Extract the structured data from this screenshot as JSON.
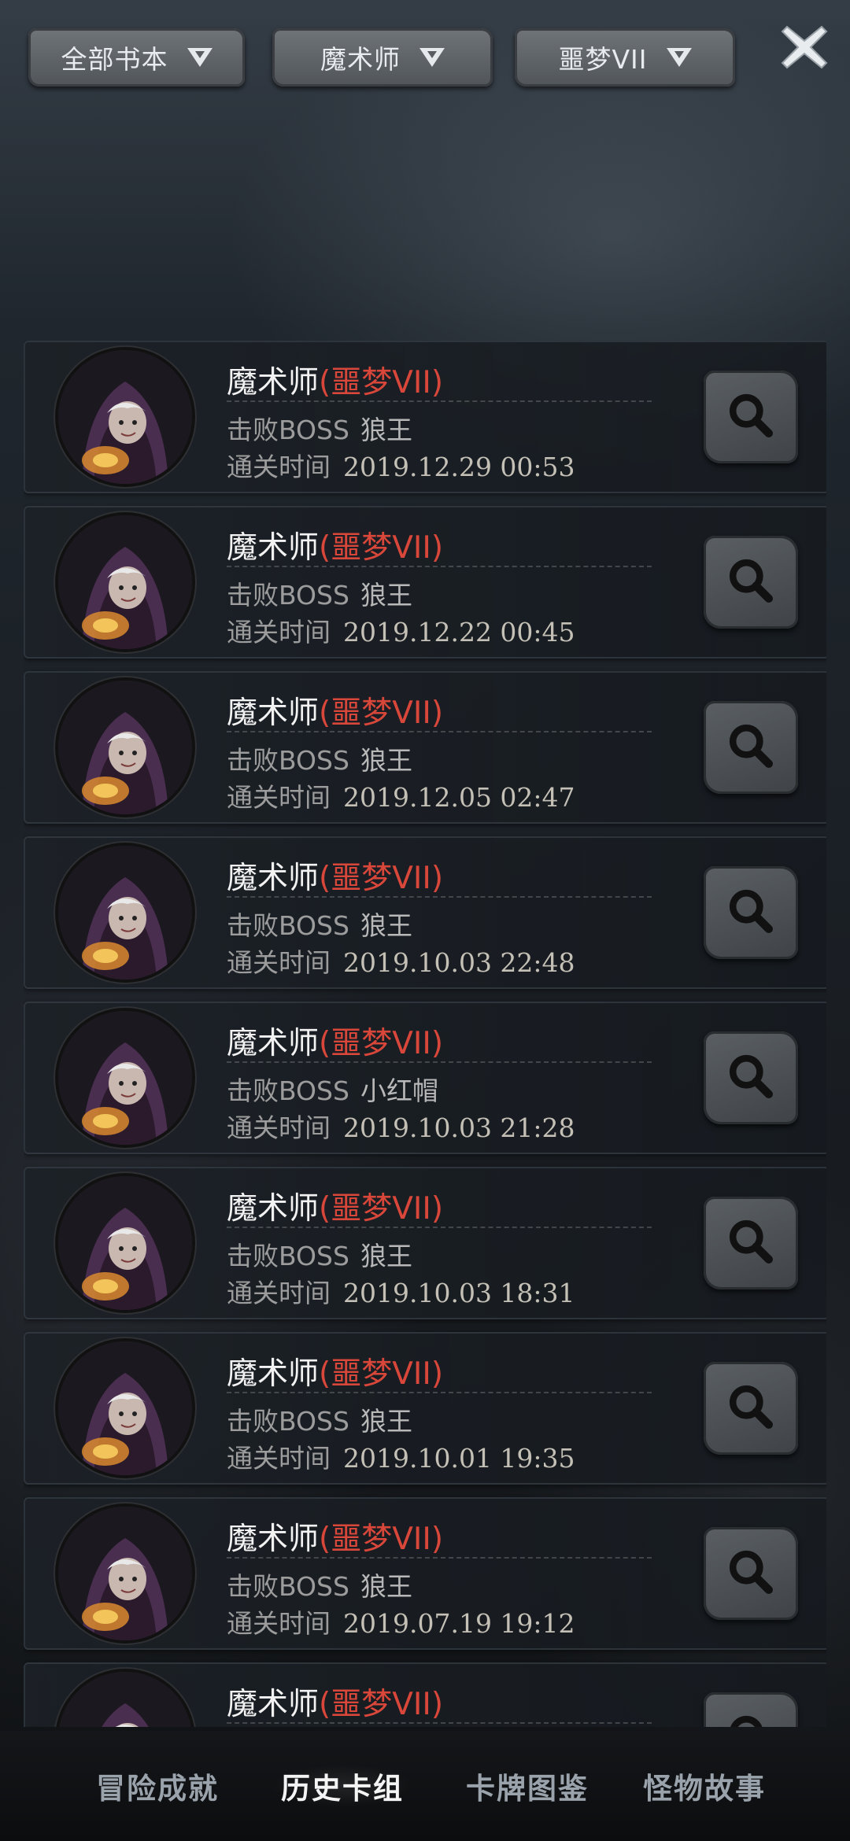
{
  "filters": [
    {
      "label": "全部书本"
    },
    {
      "label": "魔术师"
    },
    {
      "label": "噩梦VII"
    }
  ],
  "records": [
    {
      "hero": "魔术师",
      "difficulty": "(噩梦VII)",
      "boss_label": "击败BOSS",
      "boss": "狼王",
      "time_label": "通关时间",
      "time": "2019.12.29 00:53"
    },
    {
      "hero": "魔术师",
      "difficulty": "(噩梦VII)",
      "boss_label": "击败BOSS",
      "boss": "狼王",
      "time_label": "通关时间",
      "time": "2019.12.22 00:45"
    },
    {
      "hero": "魔术师",
      "difficulty": "(噩梦VII)",
      "boss_label": "击败BOSS",
      "boss": "狼王",
      "time_label": "通关时间",
      "time": "2019.12.05 02:47"
    },
    {
      "hero": "魔术师",
      "difficulty": "(噩梦VII)",
      "boss_label": "击败BOSS",
      "boss": "狼王",
      "time_label": "通关时间",
      "time": "2019.10.03 22:48"
    },
    {
      "hero": "魔术师",
      "difficulty": "(噩梦VII)",
      "boss_label": "击败BOSS",
      "boss": "小红帽",
      "time_label": "通关时间",
      "time": "2019.10.03 21:28"
    },
    {
      "hero": "魔术师",
      "difficulty": "(噩梦VII)",
      "boss_label": "击败BOSS",
      "boss": "狼王",
      "time_label": "通关时间",
      "time": "2019.10.03 18:31"
    },
    {
      "hero": "魔术师",
      "difficulty": "(噩梦VII)",
      "boss_label": "击败BOSS",
      "boss": "狼王",
      "time_label": "通关时间",
      "time": "2019.10.01 19:35"
    },
    {
      "hero": "魔术师",
      "difficulty": "(噩梦VII)",
      "boss_label": "击败BOSS",
      "boss": "狼王",
      "time_label": "通关时间",
      "time": "2019.07.19 19:12"
    },
    {
      "hero": "魔术师",
      "difficulty": "(噩梦VII)"
    }
  ],
  "tabs": [
    {
      "label": "冒险成就"
    },
    {
      "label": "历史卡组",
      "active": true
    },
    {
      "label": "卡牌图鉴"
    },
    {
      "label": "怪物故事"
    }
  ],
  "colors": {
    "difficulty": "#d9473a",
    "accent_bg": "#1b2026"
  },
  "icons": {
    "close": "close-x-icon",
    "view": "magnifier-icon",
    "dropdown": "triangle-down-icon"
  }
}
